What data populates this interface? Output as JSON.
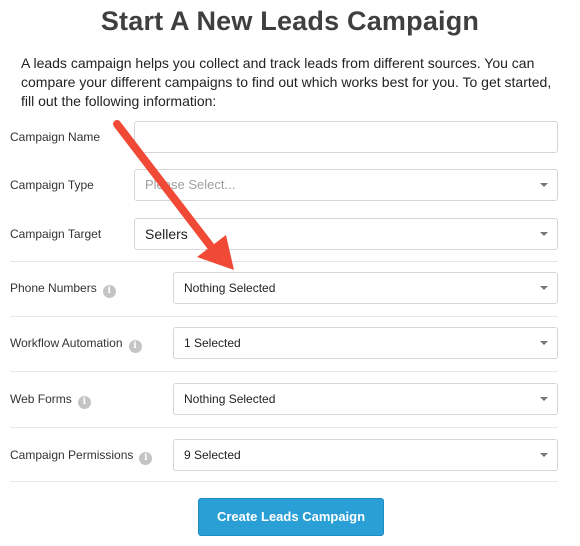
{
  "page": {
    "title": "Start A New Leads Campaign",
    "intro": "A leads campaign helps you collect and track leads from different sources. You can compare your different campaigns to find out which works best for you. To get started, fill out the following information:"
  },
  "form": {
    "campaign_name": {
      "label": "Campaign Name",
      "value": ""
    },
    "campaign_type": {
      "label": "Campaign Type",
      "placeholder": "Please Select..."
    },
    "campaign_target": {
      "label": "Campaign Target",
      "value": "Sellers"
    },
    "phone_numbers": {
      "label": "Phone Numbers",
      "value": "Nothing Selected"
    },
    "workflow_automation": {
      "label": "Workflow Automation",
      "value": "1 Selected"
    },
    "web_forms": {
      "label": "Web Forms",
      "value": "Nothing Selected"
    },
    "campaign_permissions": {
      "label": "Campaign Permissions",
      "value": "9 Selected"
    },
    "info_glyph": "i"
  },
  "actions": {
    "create_label": "Create Leads Campaign"
  },
  "colors": {
    "button": "#2a9fd6",
    "annotation_arrow": "#f04a36"
  }
}
